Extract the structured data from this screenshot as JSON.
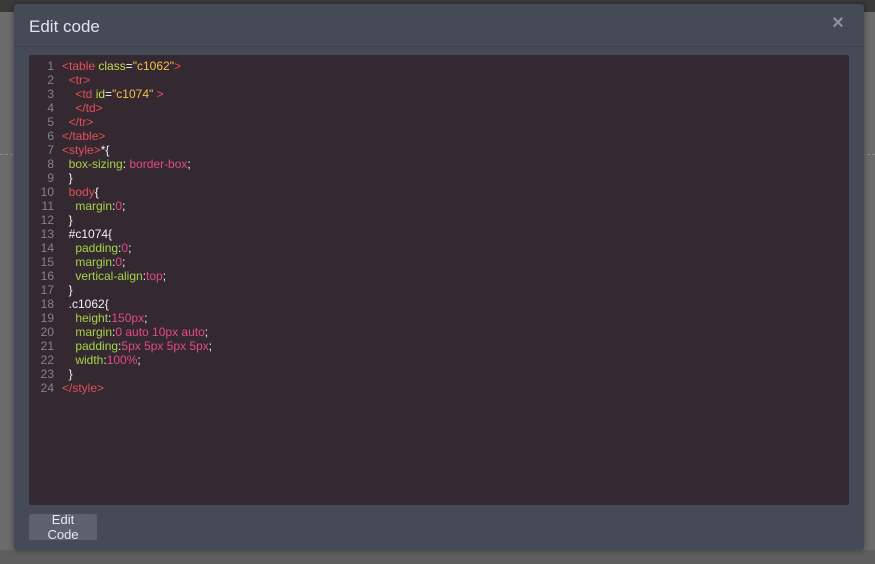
{
  "modal": {
    "title": "Edit code",
    "close_symbol": "×",
    "button_label": "Edit Code"
  },
  "code_lines": [
    {
      "num": "1",
      "tokens": [
        [
          "tag",
          "<table "
        ],
        [
          "attr",
          "class"
        ],
        [
          "plain",
          "="
        ],
        [
          "str",
          "\"c1062\""
        ],
        [
          "tag",
          ">"
        ]
      ]
    },
    {
      "num": "2",
      "tokens": [
        [
          "tag",
          "  <tr>"
        ]
      ]
    },
    {
      "num": "3",
      "tokens": [
        [
          "tag",
          "    <td "
        ],
        [
          "attr",
          "id"
        ],
        [
          "plain",
          "="
        ],
        [
          "str",
          "\"c1074\""
        ],
        [
          "tag",
          " >"
        ]
      ]
    },
    {
      "num": "4",
      "tokens": [
        [
          "tag",
          "    </td>"
        ]
      ]
    },
    {
      "num": "5",
      "tokens": [
        [
          "tag",
          "  </tr>"
        ]
      ]
    },
    {
      "num": "6",
      "tokens": [
        [
          "tag",
          "</table>"
        ]
      ]
    },
    {
      "num": "7",
      "tokens": [
        [
          "tag",
          "<style>"
        ],
        [
          "plain",
          "*{"
        ]
      ]
    },
    {
      "num": "8",
      "tokens": [
        [
          "prop",
          "  box-sizing"
        ],
        [
          "plain",
          ": "
        ],
        [
          "val",
          "border-box"
        ],
        [
          "plain",
          ";"
        ]
      ]
    },
    {
      "num": "9",
      "tokens": [
        [
          "plain",
          "  }"
        ]
      ]
    },
    {
      "num": "10",
      "tokens": [
        [
          "kw",
          "  body"
        ],
        [
          "plain",
          "{"
        ]
      ]
    },
    {
      "num": "11",
      "tokens": [
        [
          "prop",
          "    margin"
        ],
        [
          "plain",
          ":"
        ],
        [
          "val",
          "0"
        ],
        [
          "plain",
          ";"
        ]
      ]
    },
    {
      "num": "12",
      "tokens": [
        [
          "plain",
          "  }"
        ]
      ]
    },
    {
      "num": "13",
      "tokens": [
        [
          "sel",
          "  #c1074"
        ],
        [
          "plain",
          "{"
        ]
      ]
    },
    {
      "num": "14",
      "tokens": [
        [
          "prop",
          "    padding"
        ],
        [
          "plain",
          ":"
        ],
        [
          "val",
          "0"
        ],
        [
          "plain",
          ";"
        ]
      ]
    },
    {
      "num": "15",
      "tokens": [
        [
          "prop",
          "    margin"
        ],
        [
          "plain",
          ":"
        ],
        [
          "val",
          "0"
        ],
        [
          "plain",
          ";"
        ]
      ]
    },
    {
      "num": "16",
      "tokens": [
        [
          "prop",
          "    vertical-align"
        ],
        [
          "plain",
          ":"
        ],
        [
          "val",
          "top"
        ],
        [
          "plain",
          ";"
        ]
      ]
    },
    {
      "num": "17",
      "tokens": [
        [
          "plain",
          "  }"
        ]
      ]
    },
    {
      "num": "18",
      "tokens": [
        [
          "sel",
          "  .c1062"
        ],
        [
          "plain",
          "{"
        ]
      ]
    },
    {
      "num": "19",
      "tokens": [
        [
          "prop",
          "    height"
        ],
        [
          "plain",
          ":"
        ],
        [
          "val",
          "150px"
        ],
        [
          "plain",
          ";"
        ]
      ]
    },
    {
      "num": "20",
      "tokens": [
        [
          "prop",
          "    margin"
        ],
        [
          "plain",
          ":"
        ],
        [
          "val",
          "0 auto 10px auto"
        ],
        [
          "plain",
          ";"
        ]
      ]
    },
    {
      "num": "21",
      "tokens": [
        [
          "prop",
          "    padding"
        ],
        [
          "plain",
          ":"
        ],
        [
          "val",
          "5px 5px 5px 5px"
        ],
        [
          "plain",
          ";"
        ]
      ]
    },
    {
      "num": "22",
      "tokens": [
        [
          "prop",
          "    width"
        ],
        [
          "plain",
          ":"
        ],
        [
          "val",
          "100%"
        ],
        [
          "plain",
          ";"
        ]
      ]
    },
    {
      "num": "23",
      "tokens": [
        [
          "plain",
          "  }"
        ]
      ]
    },
    {
      "num": "24",
      "tokens": [
        [
          "tag",
          "</style>"
        ]
      ]
    }
  ]
}
